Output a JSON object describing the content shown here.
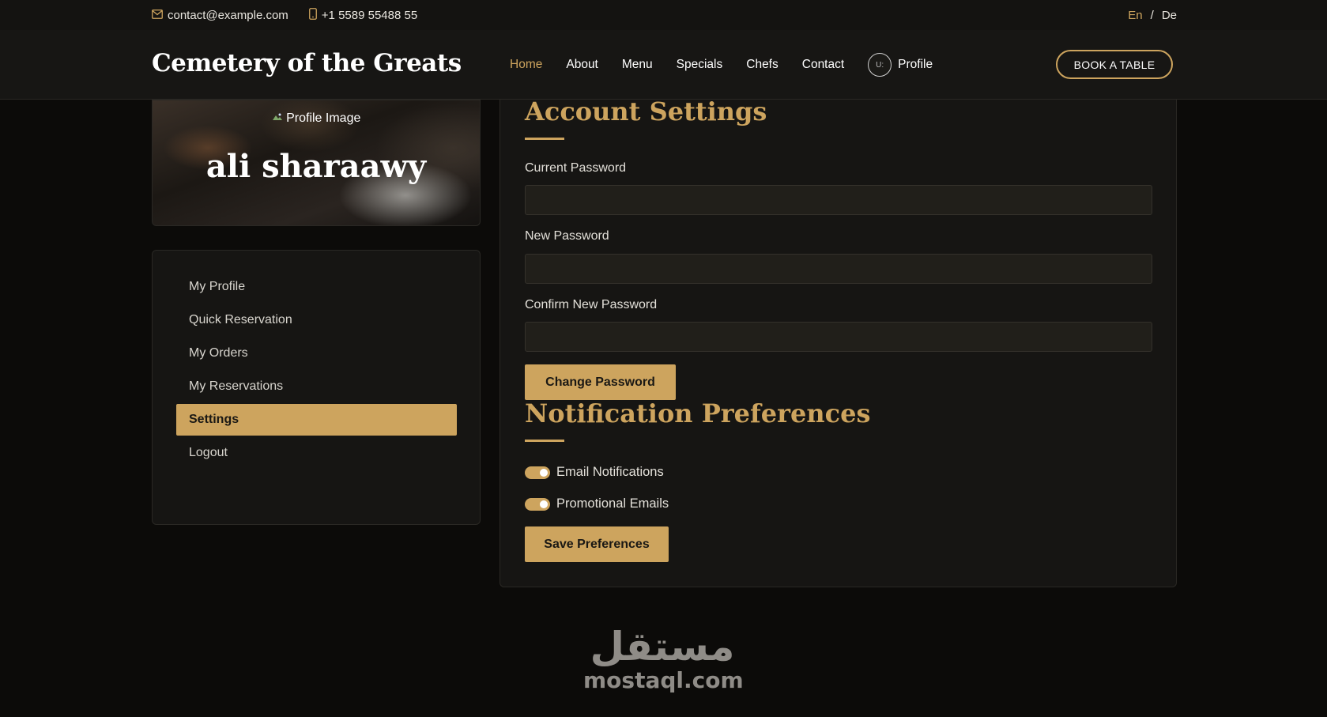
{
  "topbar": {
    "email": "contact@example.com",
    "phone": "+1 5589 55488 55",
    "lang_en": "En",
    "lang_sep": "/",
    "lang_de": "De"
  },
  "header": {
    "brand": "Cemetery of the Greats",
    "nav": [
      "Home",
      "About",
      "Menu",
      "Specials",
      "Chefs",
      "Contact"
    ],
    "avatar_alt": "U:",
    "profile_label": "Profile",
    "book_button": "BOOK A TABLE"
  },
  "profile_card": {
    "image_alt": "Profile Image",
    "name": "ali sharaawy"
  },
  "sidebar": {
    "items": [
      "My Profile",
      "Quick Reservation",
      "My Orders",
      "My Reservations",
      "Settings",
      "Logout"
    ],
    "active_index": 4
  },
  "account": {
    "title": "Account Settings",
    "current_password_label": "Current Password",
    "current_password_value": "",
    "new_password_label": "New Password",
    "new_password_value": "",
    "confirm_password_label": "Confirm New Password",
    "confirm_password_value": "",
    "change_button": "Change Password"
  },
  "notifications": {
    "title": "Notification Preferences",
    "email_label": "Email Notifications",
    "email_on": true,
    "promo_label": "Promotional Emails",
    "promo_on": true,
    "save_button": "Save Preferences"
  },
  "watermark": {
    "arabic": "مستقل",
    "latin": "mostaql.com"
  },
  "colors": {
    "accent": "#cda45e",
    "background": "#0c0b09",
    "panel": "#161513"
  }
}
